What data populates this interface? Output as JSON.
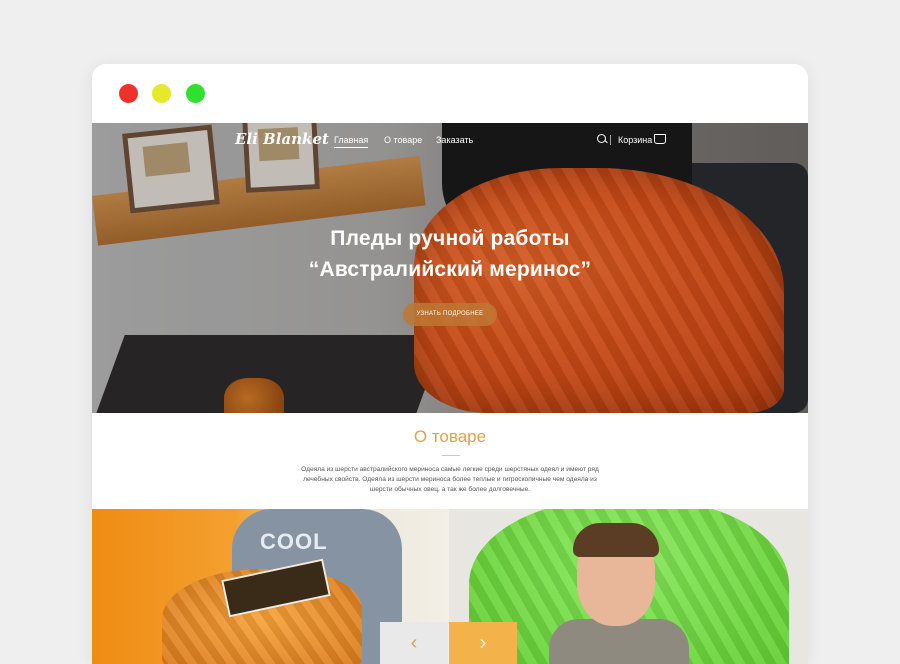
{
  "window_controls": [
    "close",
    "minimize",
    "maximize"
  ],
  "nav": {
    "logo": "Eli Blanket",
    "items": [
      "Главная",
      "О товаре",
      "Заказать"
    ],
    "active_index": 0,
    "cart_label": "Корзина",
    "search_icon": "search-icon",
    "cart_icon": "basket-icon"
  },
  "hero": {
    "title_line1": "Пледы  ручной работы",
    "title_line2": "“Австралийский меринос”",
    "button_label": "УЗНАТЬ ПОДРОБНЕЕ"
  },
  "about": {
    "title": "О товаре",
    "text": "Одеяла из шерсти австралийского мериноса самые легкие среди шерстяных одеял и имеют ряд лечебных свойств. Одеяла из шерсти мериноса более теплые и гигроскопичные чем одеяла из шерсти обычных овец, а так же более долговечные."
  },
  "gallery": {
    "prev_icon": "chevron-left-icon",
    "next_icon": "chevron-right-icon",
    "prev_glyph": "‹",
    "next_glyph": "›",
    "left_shirt_text": "COOL"
  },
  "colors": {
    "accent": "#e0a24a",
    "close": "#f0302b",
    "minimize": "#e6e82b",
    "maximize": "#30e030"
  }
}
